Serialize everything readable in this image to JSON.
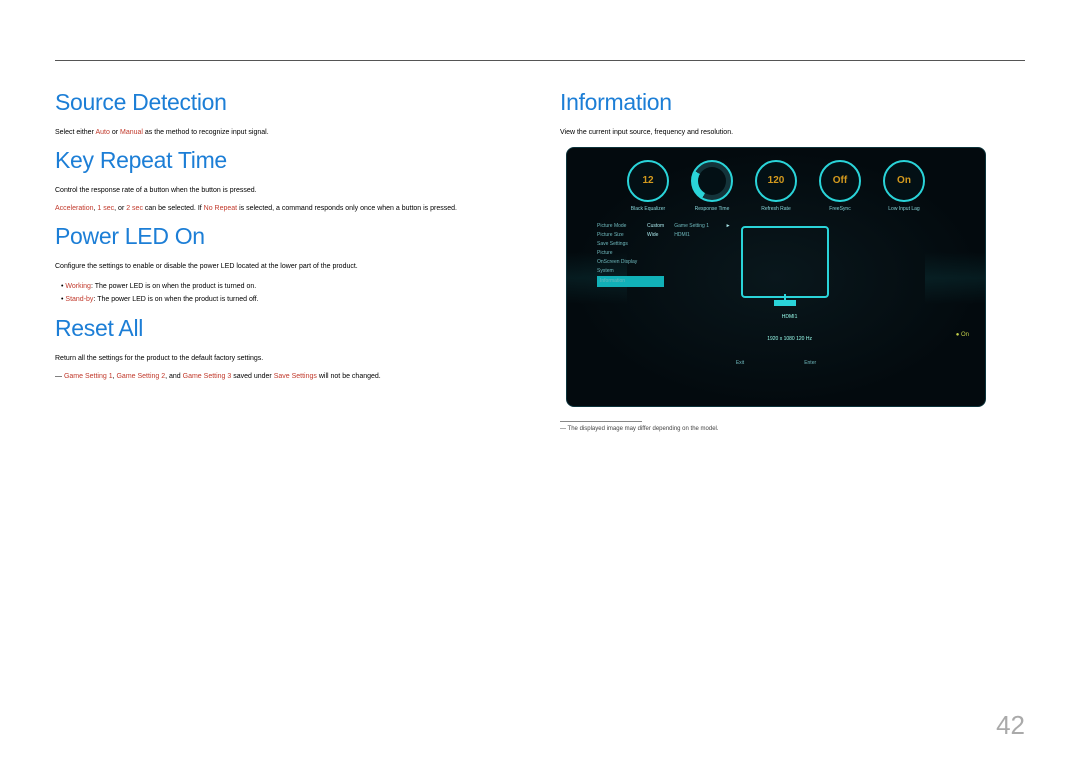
{
  "page_number": "42",
  "left": {
    "source_detection": {
      "heading": "Source Detection",
      "text_prefix": "Select either ",
      "opt1": "Auto",
      "mid": " or ",
      "opt2": "Manual",
      "text_suffix": " as the method to recognize input signal."
    },
    "key_repeat": {
      "heading": "Key Repeat Time",
      "line1_pre": "Control the response rate of a button when the button is pressed.",
      "line2_a": "Acceleration",
      "line2_b": ", ",
      "line2_c": "1 sec",
      "line2_d": ", or ",
      "line2_e": "2 sec",
      "line2_f": " can be selected. If ",
      "line2_g": "No Repeat",
      "line2_h": " is selected, a command responds only once when a button is pressed."
    },
    "power_led": {
      "heading": "Power LED On",
      "text": "Configure the settings to enable or disable the power LED located at the lower part of the product.",
      "b1a": "Working",
      "b1b": ": The power LED is on when the product is turned on.",
      "b2a": "Stand-by",
      "b2b": ": The power LED is on when the product is turned off."
    },
    "reset_all": {
      "heading": "Reset All",
      "text": "Return all the settings for the product to the default factory settings.",
      "fn_pre": "― ",
      "fn1": "Game Setting 1",
      "fn_c1": ", ",
      "fn2": "Game Setting 2",
      "fn_c2": ", and ",
      "fn3": "Game Setting 3",
      "fn_c3": " saved under ",
      "fn4": "Save Settings",
      "fn_end": " will not be changed."
    }
  },
  "right": {
    "heading": "Information",
    "intro": "View the current input source, frequency and resolution.",
    "footnote": "― The displayed image may differ depending on the model.",
    "panel": {
      "circles": {
        "c1": "12",
        "c1_caption": "Black Equalizer",
        "c2": "",
        "c2_caption": "Response Time",
        "c3": "120",
        "c3_caption": "Refresh Rate",
        "c4": "Off",
        "c4_caption": "FreeSync",
        "c5": "On",
        "c5_caption": "Low Input Lag"
      },
      "table_left": {
        "r1k": "Picture Mode",
        "r1v": "Custom",
        "r2k": "Picture Size",
        "r2v": "Wide",
        "r3k": "Save Settings",
        "r3v": "",
        "r4k": "Picture",
        "r4v": "",
        "r5k": "OnScreen Display",
        "r5v": "",
        "r6k": "System",
        "r6v": "",
        "r7k": "Information",
        "r7v": ""
      },
      "table_right": {
        "r1k": "Game Setting 1",
        "r1v": "",
        "r2k": "HDMI1",
        "r2v": ""
      },
      "port": "HDMI1",
      "res": "1920 x 1080  120 Hz",
      "exit": "Exit",
      "enter": "Enter",
      "on_icon": "● On"
    }
  }
}
